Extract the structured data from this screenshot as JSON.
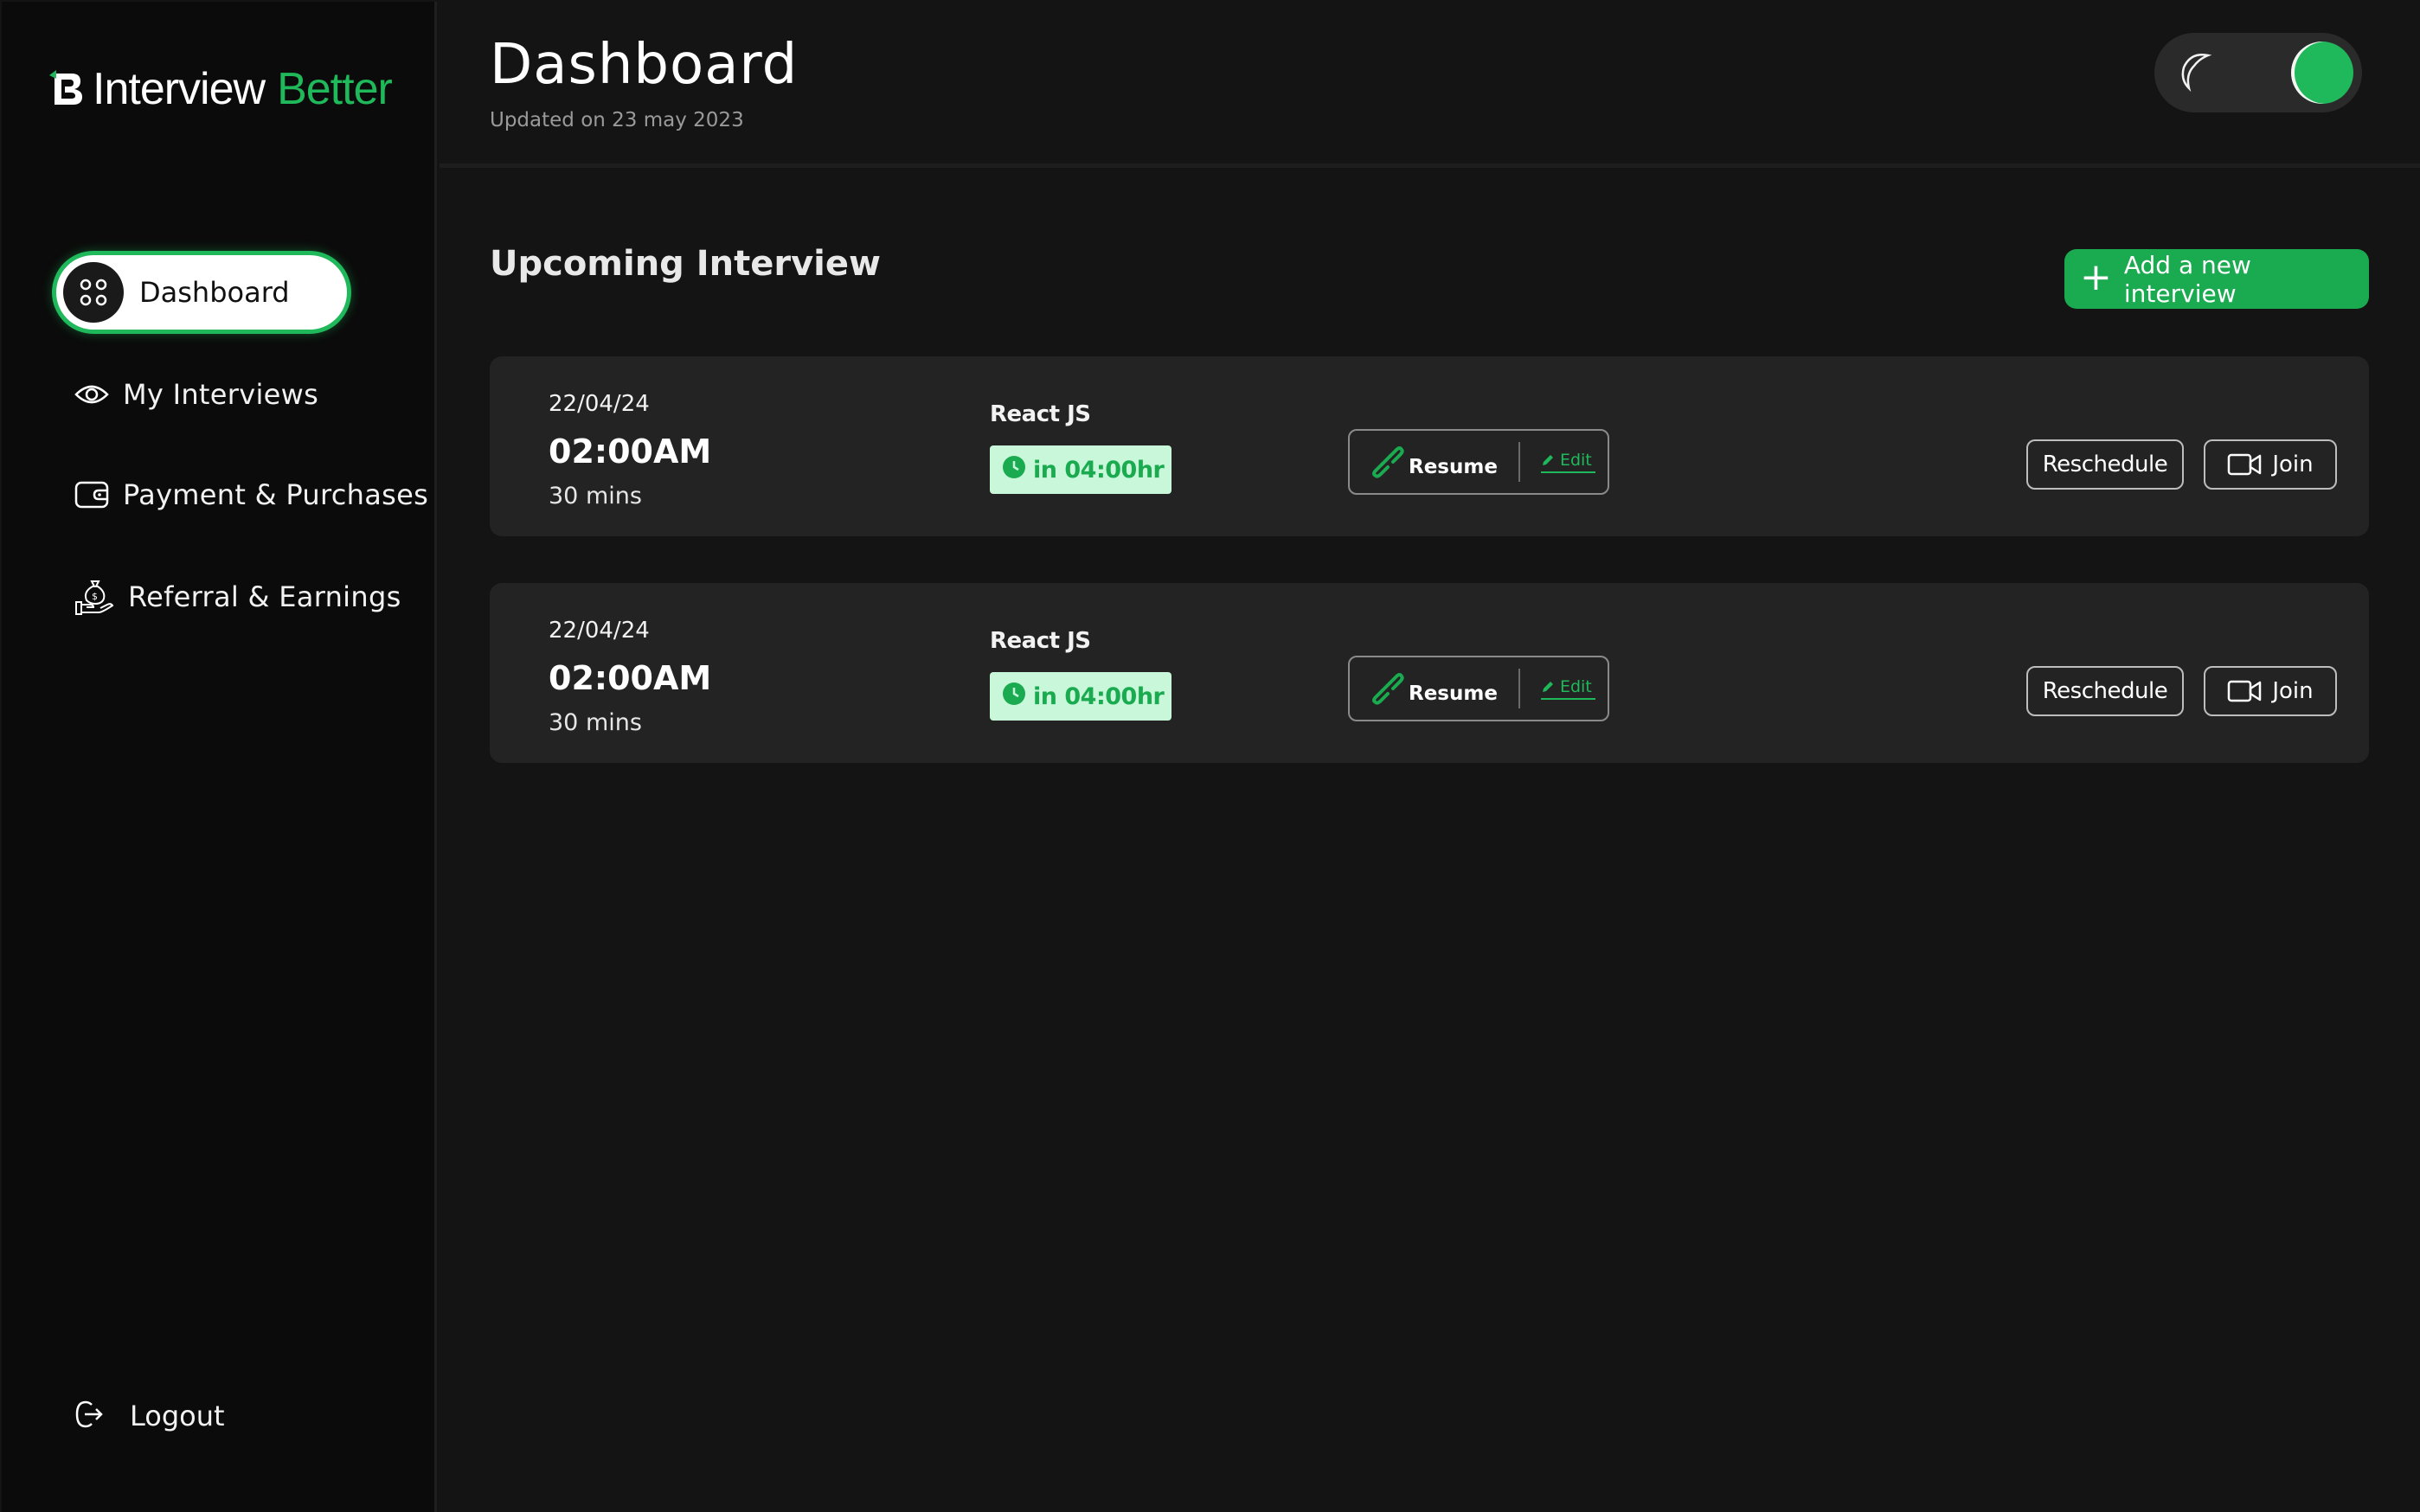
{
  "brand": {
    "name_white": "Interview",
    "name_green": "Better"
  },
  "sidebar": {
    "items": [
      {
        "label": "Dashboard",
        "icon": "dashboard-grid-icon",
        "active": true
      },
      {
        "label": "My Interviews",
        "icon": "eye-icon"
      },
      {
        "label": "Payment & Purchases",
        "icon": "wallet-icon"
      },
      {
        "label": "Referral & Earnings",
        "icon": "money-bag-hand-icon"
      }
    ],
    "logout": {
      "label": "Logout",
      "icon": "logout-icon"
    }
  },
  "header": {
    "title": "Dashboard",
    "subtitle": "Updated on 23 may 2023",
    "theme_toggle": {
      "mode": "dark",
      "icon": "moon-icon"
    }
  },
  "main": {
    "section_title": "Upcoming Interview",
    "add_button": "Add a new interview",
    "interviews": [
      {
        "date": "22/04/24",
        "time": "02:00AM",
        "duration": "30 mins",
        "tech": "React JS",
        "countdown": "in 04:00hr",
        "resume_label": "Resume",
        "edit_label": "Edit",
        "reschedule_label": "Reschedule",
        "join_label": "Join"
      },
      {
        "date": "22/04/24",
        "time": "02:00AM",
        "duration": "30 mins",
        "tech": "React JS",
        "countdown": "in 04:00hr",
        "resume_label": "Resume",
        "edit_label": "Edit",
        "reschedule_label": "Reschedule",
        "join_label": "Join"
      }
    ]
  },
  "colors": {
    "accent": "#1fb85a",
    "background": "#141414",
    "sidebar": "#0b0b0b",
    "card": "#232323",
    "badge_bg": "#c9f7da"
  }
}
